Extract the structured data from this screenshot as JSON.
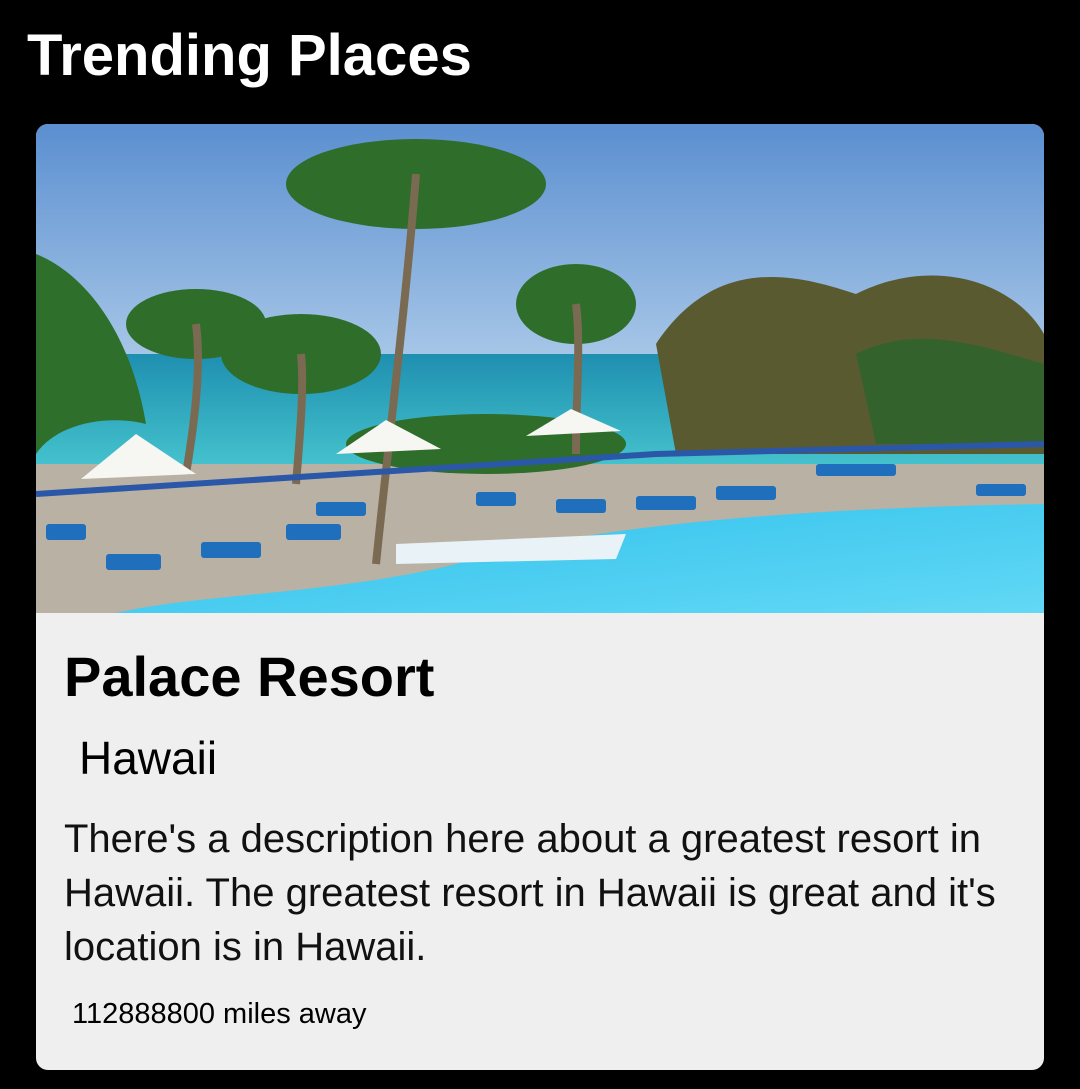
{
  "header": {
    "title": "Trending Places"
  },
  "card": {
    "image_alt": "Resort pool with palm trees by the ocean",
    "name": "Palace Resort",
    "location": "Hawaii",
    "description": "There's a description here about a greatest resort in Hawaii. The greatest resort in Hawaii is great and it's location is in Hawaii.",
    "distance": "112888800 miles away"
  },
  "colors": {
    "background": "#000000",
    "card_background": "#efefef",
    "title_text": "#ffffff",
    "body_text": "#000000"
  }
}
